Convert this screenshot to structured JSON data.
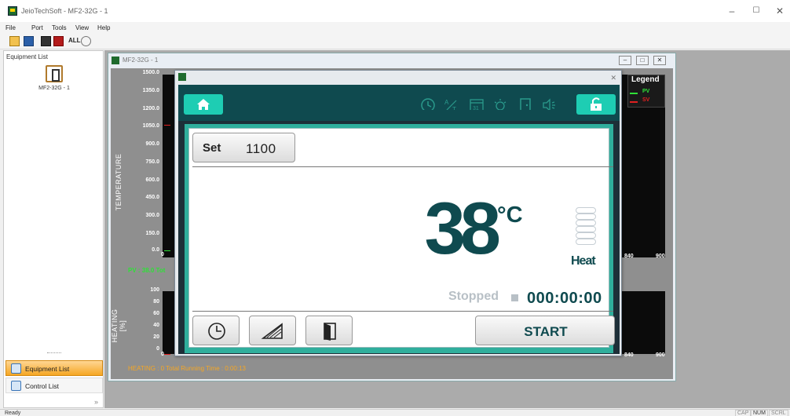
{
  "app": {
    "title": "JeioTechSoft - MF2-32G - 1"
  },
  "menu": [
    "File",
    "Port",
    "Tools",
    "View",
    "Help"
  ],
  "toolbar": {
    "all_label": "ALL"
  },
  "sidebar": {
    "title": "Equipment List",
    "equipment": [
      {
        "name": "MF2-32G - 1",
        "icon": "furnace-icon"
      }
    ],
    "tabs": [
      {
        "label": "Equipment List",
        "active": true
      },
      {
        "label": "Control List",
        "active": false
      }
    ],
    "collapse_glyph": "»"
  },
  "status": {
    "left": "Ready",
    "keys": [
      "CAP",
      "NUM",
      "SCRL"
    ]
  },
  "graph_window": {
    "title": "MF2-32G - 1",
    "temp_axis": {
      "label": "TEMPERATURE",
      "ticks": [
        "1500.0",
        "1350.0",
        "1200.0",
        "1050.0",
        "900.0",
        "750.0",
        "600.0",
        "450.0",
        "300.0",
        "150.0",
        "0.0"
      ]
    },
    "heat_axis": {
      "label": "HEATING [%]",
      "ticks": [
        "100",
        "80",
        "60",
        "40",
        "20",
        "0"
      ]
    },
    "x_ticks_left": "0",
    "x_ticks_right": [
      "840",
      "900"
    ],
    "pv_readout": "PV : 38.0  Tot",
    "heating_readout": "HEATING : 0  Total Running Time : 0:00:13",
    "legend": {
      "title": "Legend",
      "items": [
        {
          "name": "PV",
          "color": "#2fe038"
        },
        {
          "name": "SV",
          "color": "#e02020"
        }
      ]
    }
  },
  "controller": {
    "set_label": "Set",
    "set_value": "1100",
    "temperature": "38",
    "unit": "°C",
    "heater_label": "Heat",
    "run_state": "Stopped",
    "run_time": "000:00:00",
    "start_label": "START",
    "header_icons": [
      "clock-icon",
      "auto-tune-icon",
      "calendar-icon",
      "lamp-icon",
      "door-icon",
      "speaker-icon"
    ],
    "colors": {
      "accent": "#1ecdb3",
      "header": "#0f4a4f",
      "body": "#2fae9c",
      "text": "#0f4a4f"
    }
  }
}
